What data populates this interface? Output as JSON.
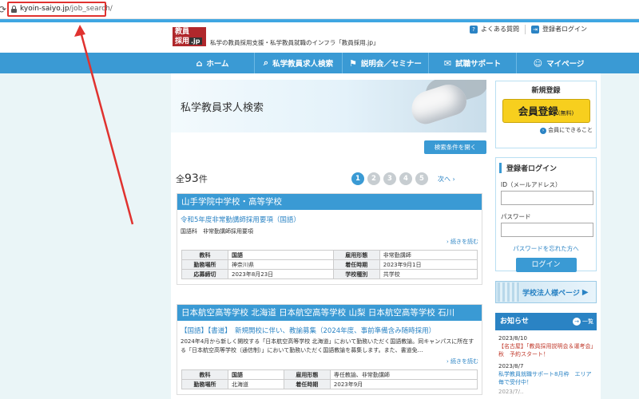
{
  "browser": {
    "reload_icon": "reload-icon",
    "url_host": "kyoin-saiyo.jp",
    "url_path": "/job_search/"
  },
  "header": {
    "logo_line1": "教員",
    "logo_line2": "採用",
    "logo_jp": ".jp",
    "tagline": "私学の教員採用支援・私学教員就職のインフラ「教員採用.jp」",
    "faq_label": "よくある質問",
    "member_login_label": "登録者ログイン"
  },
  "nav": [
    {
      "label": "ホーム",
      "icon": "home-icon",
      "glyph": "⌂"
    },
    {
      "label": "私学教員求人検索",
      "icon": "search-icon",
      "glyph": "⌕"
    },
    {
      "label": "説明会／セミナー",
      "icon": "flag-icon",
      "glyph": "⚑"
    },
    {
      "label": "試職サポート",
      "icon": "speech-icon",
      "glyph": "✉"
    },
    {
      "label": "マイページ",
      "icon": "user-icon",
      "glyph": "☺"
    }
  ],
  "hero": {
    "title": "私学教員求人検索",
    "filter_button": "検索条件を開く"
  },
  "results": {
    "prefix": "全",
    "count": "93",
    "suffix": "件",
    "pages": [
      "1",
      "2",
      "3",
      "4",
      "5"
    ],
    "current_page": "1",
    "next_label": "次へ ›"
  },
  "jobs": [
    {
      "school": "山手学院中学校・高等学校",
      "title": "令和5年度非常勤講師採用要項（国語）",
      "subtitle": "国語科　非常勤講師採用要項",
      "more": "続きを読む",
      "rows": [
        [
          "教科",
          "国語",
          "雇用形態",
          "非常勤講師"
        ],
        [
          "勤務場所",
          "神奈川県",
          "着任時期",
          "2023年9月1日"
        ],
        [
          "応募締切",
          "2023年8月23日",
          "学校種別",
          "共学校"
        ]
      ]
    },
    {
      "school": "日本航空高等学校 北海道 日本航空高等学校 山梨 日本航空高等学校 石川",
      "title": "【国語】【書道】　新規開校に伴い、教諭募集（2024年度、事前準備含み随時採用）",
      "description": "2024年4月から新しく開校する「日本航空高等学校 北海道」において勤務いただく国語教諭。同キャンパスに所在する「日本航空高等学校（通信制）」において勤務いただく国語教諭を募集します。また、書道免…",
      "more": "続きを読む",
      "rows": [
        [
          "教科",
          "国語",
          "雇用形態",
          "専任教諭、非常勤講師"
        ],
        [
          "勤務場所",
          "北海道",
          "着任時期",
          "2023年9月"
        ]
      ]
    }
  ],
  "sidebar": {
    "register_title": "新規登録",
    "register_button": "会員登録",
    "register_free": "(無料)",
    "register_note": "会員にできること",
    "login_title": "登録者ログイン",
    "id_label": "ID（メールアドレス）",
    "password_label": "パスワード",
    "forgot_label": "パスワードを忘れた方へ",
    "login_button": "ログイン",
    "banner_label": "学校法人様ページ",
    "news_title": "お知らせ",
    "news_all": "一覧",
    "news": [
      {
        "date": "2023/8/10",
        "text": "【名古屋】「教員採用説明会＆運考会」秋　予約スタート！"
      },
      {
        "date": "2023/8/7",
        "text": "私学教員就職サポート8月枠　エリア毎で受付中！"
      },
      {
        "date": "2023/7/..",
        "text": ""
      }
    ]
  },
  "colors": {
    "accent": "#3a9ad4",
    "annotation": "#e0322f",
    "button_yellow": "#f7cf1e"
  }
}
